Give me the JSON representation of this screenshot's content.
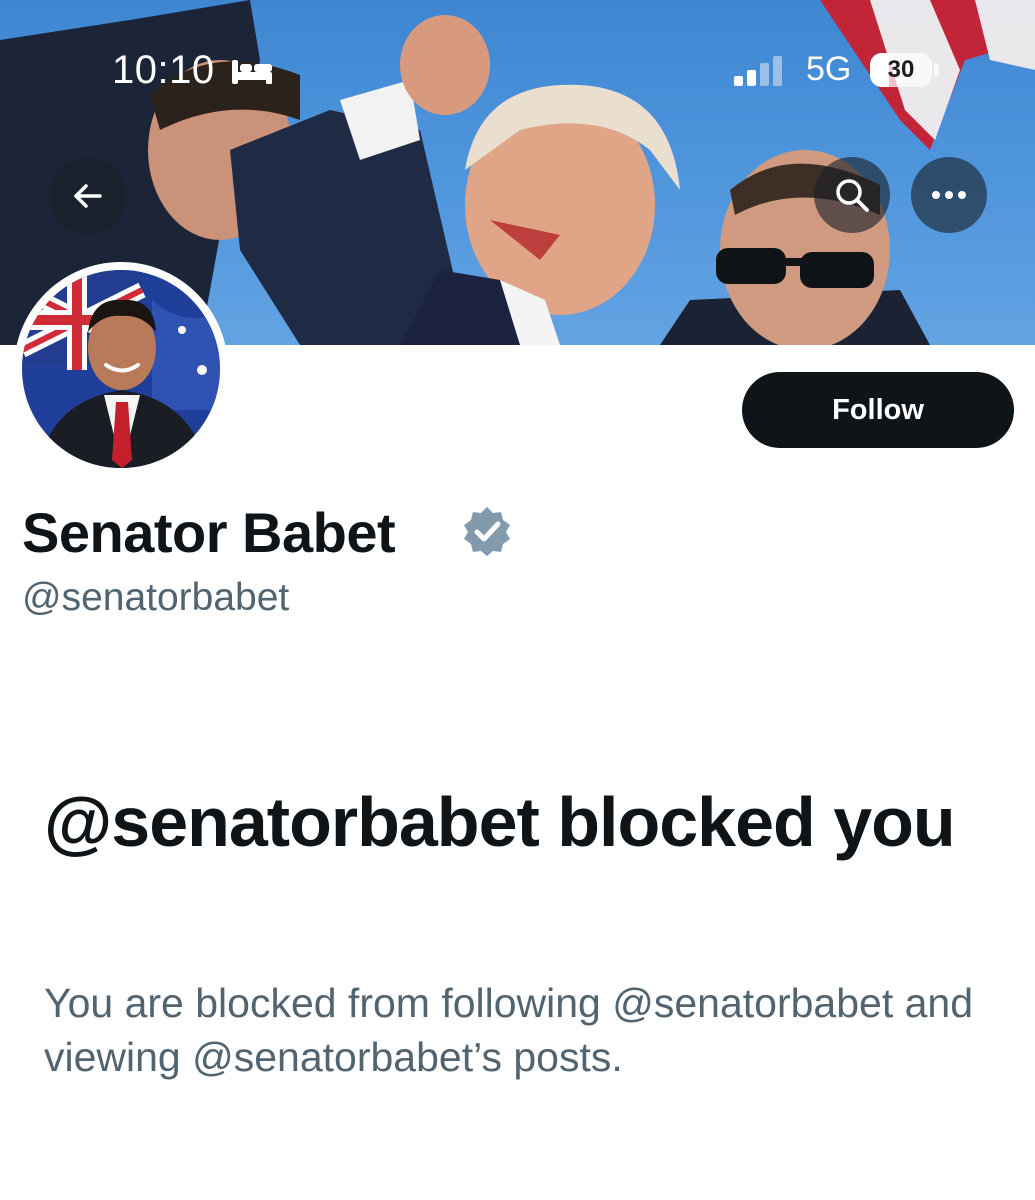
{
  "status_bar": {
    "time": "10:10",
    "sleep_icon": "bed-icon",
    "signal_icon": "cellular-signal-icon",
    "network": "5G",
    "battery_percent": "30"
  },
  "nav": {
    "back_icon": "arrow-left-icon",
    "search_icon": "search-icon",
    "more_icon": "ellipsis-icon"
  },
  "profile": {
    "display_name": "Senator Babet",
    "verified_icon": "verified-badge-icon",
    "handle": "@senatorbabet",
    "follow_label": "Follow"
  },
  "blocked": {
    "title": "@senatorbabet blocked you",
    "description": "You are blocked from following @senatorbabet and viewing @senatorbabet’s posts."
  },
  "colors": {
    "primary_text": "#0f1419",
    "secondary_text": "#536471",
    "follow_button_bg": "#0f1419",
    "verified_badge": "#829aab",
    "banner_sky": "#4d94dc"
  }
}
